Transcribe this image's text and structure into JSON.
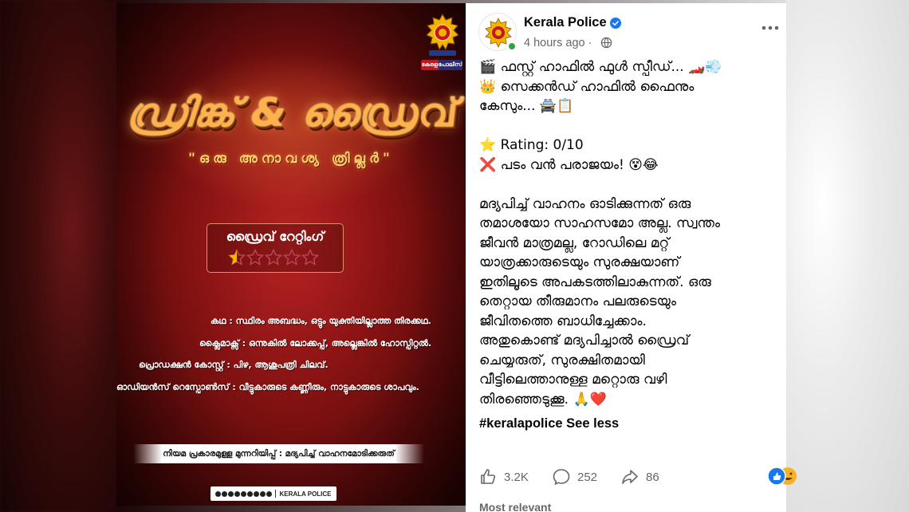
{
  "poster": {
    "emblem_tag_left": "കേരള",
    "emblem_tag_right": "പോലീസ്",
    "title": "ഡ്രിങ്ക് & ഡ്രൈവ്",
    "subtitle": "\"ഒരു അനാവശ്യ ത്രില്ലർ\"",
    "rating_label": "ഡ്രൈവ് റേറ്റിംഗ്",
    "rating_value": 0.5,
    "rating_max": 5,
    "credits": [
      "കഥ : സ്ഥിരം അബദ്ധം, ഒട്ടും യുക്തിയില്ലാത്ത തിരക്കഥ.",
      "ക്ലൈമാക്സ് : ഒന്നുകിൽ ലോക്കപ്പ്, അല്ലെങ്കിൽ ഹോസ്പിറ്റൽ.",
      "പ്രൊഡക്ഷൻ കോസ്റ്റ് : പിഴ, ആശുപത്രി ചിലവ്.",
      "ഓഡിയൻസ് റെസ്പോൺസ് : വീട്ടുകാരുടെ കണ്ണീരും, നാട്ടുകാരുടെ ശാപവും."
    ],
    "warning": "നിയമ പ്രകാരമുള്ള മുന്നറിയിപ്പ് : മദ്യപിച്ച് വാഹനമോടിക്കരുത്",
    "footer_brand": "KERALA POLICE"
  },
  "post": {
    "page_name": "Kerala Police",
    "time": "4 hours ago ·",
    "lines": [
      "🎬 ഫസ്റ്റ് ഹാഫിൽ ഫുൾ സ്പീഡ്... 🏎️💨",
      "👑 സെക്കൻഡ് ഹാഫിൽ ഫൈനും",
      "കേസും... 🚔📋",
      "",
      "⭐ Rating: 0/10",
      "❌ പടം വൻ പരാജയം! 😵😂",
      "",
      "മദ്യപിച്ച് വാഹനം ഓടിക്കുന്നത് ഒരു",
      "തമാശയോ സാഹസമോ അല്ല. സ്വന്തം",
      "ജീവൻ മാത്രമല്ല, റോഡിലെ മറ്റ്",
      "യാത്രക്കാരുടെയും സുരക്ഷയാണ്",
      "ഇതിലൂടെ അപകടത്തിലാകുന്നത്. ഒരു",
      "തെറ്റായ തീരുമാനം പലരുടെയും",
      "ജീവിതത്തെ ബാധിച്ചേക്കാം.",
      "അതുകൊണ്ട് മദ്യപിച്ചാൽ ഡ്രൈവ്",
      "ചെയ്യരുത്, സുരക്ഷിതമായി",
      "വീട്ടിലെത്താനുള്ള മറ്റൊരു വഴി",
      "തിരഞ്ഞെടുക്കൂ. 🙏❤️"
    ],
    "hashtag": "#keralapolice",
    "see_less": "See less",
    "likes": "3.2K",
    "comments": "252",
    "shares": "86",
    "more_relevant": "Most relevant",
    "colors": {
      "like_blue": "#1877f2",
      "verified_blue": "#1877f2"
    }
  }
}
